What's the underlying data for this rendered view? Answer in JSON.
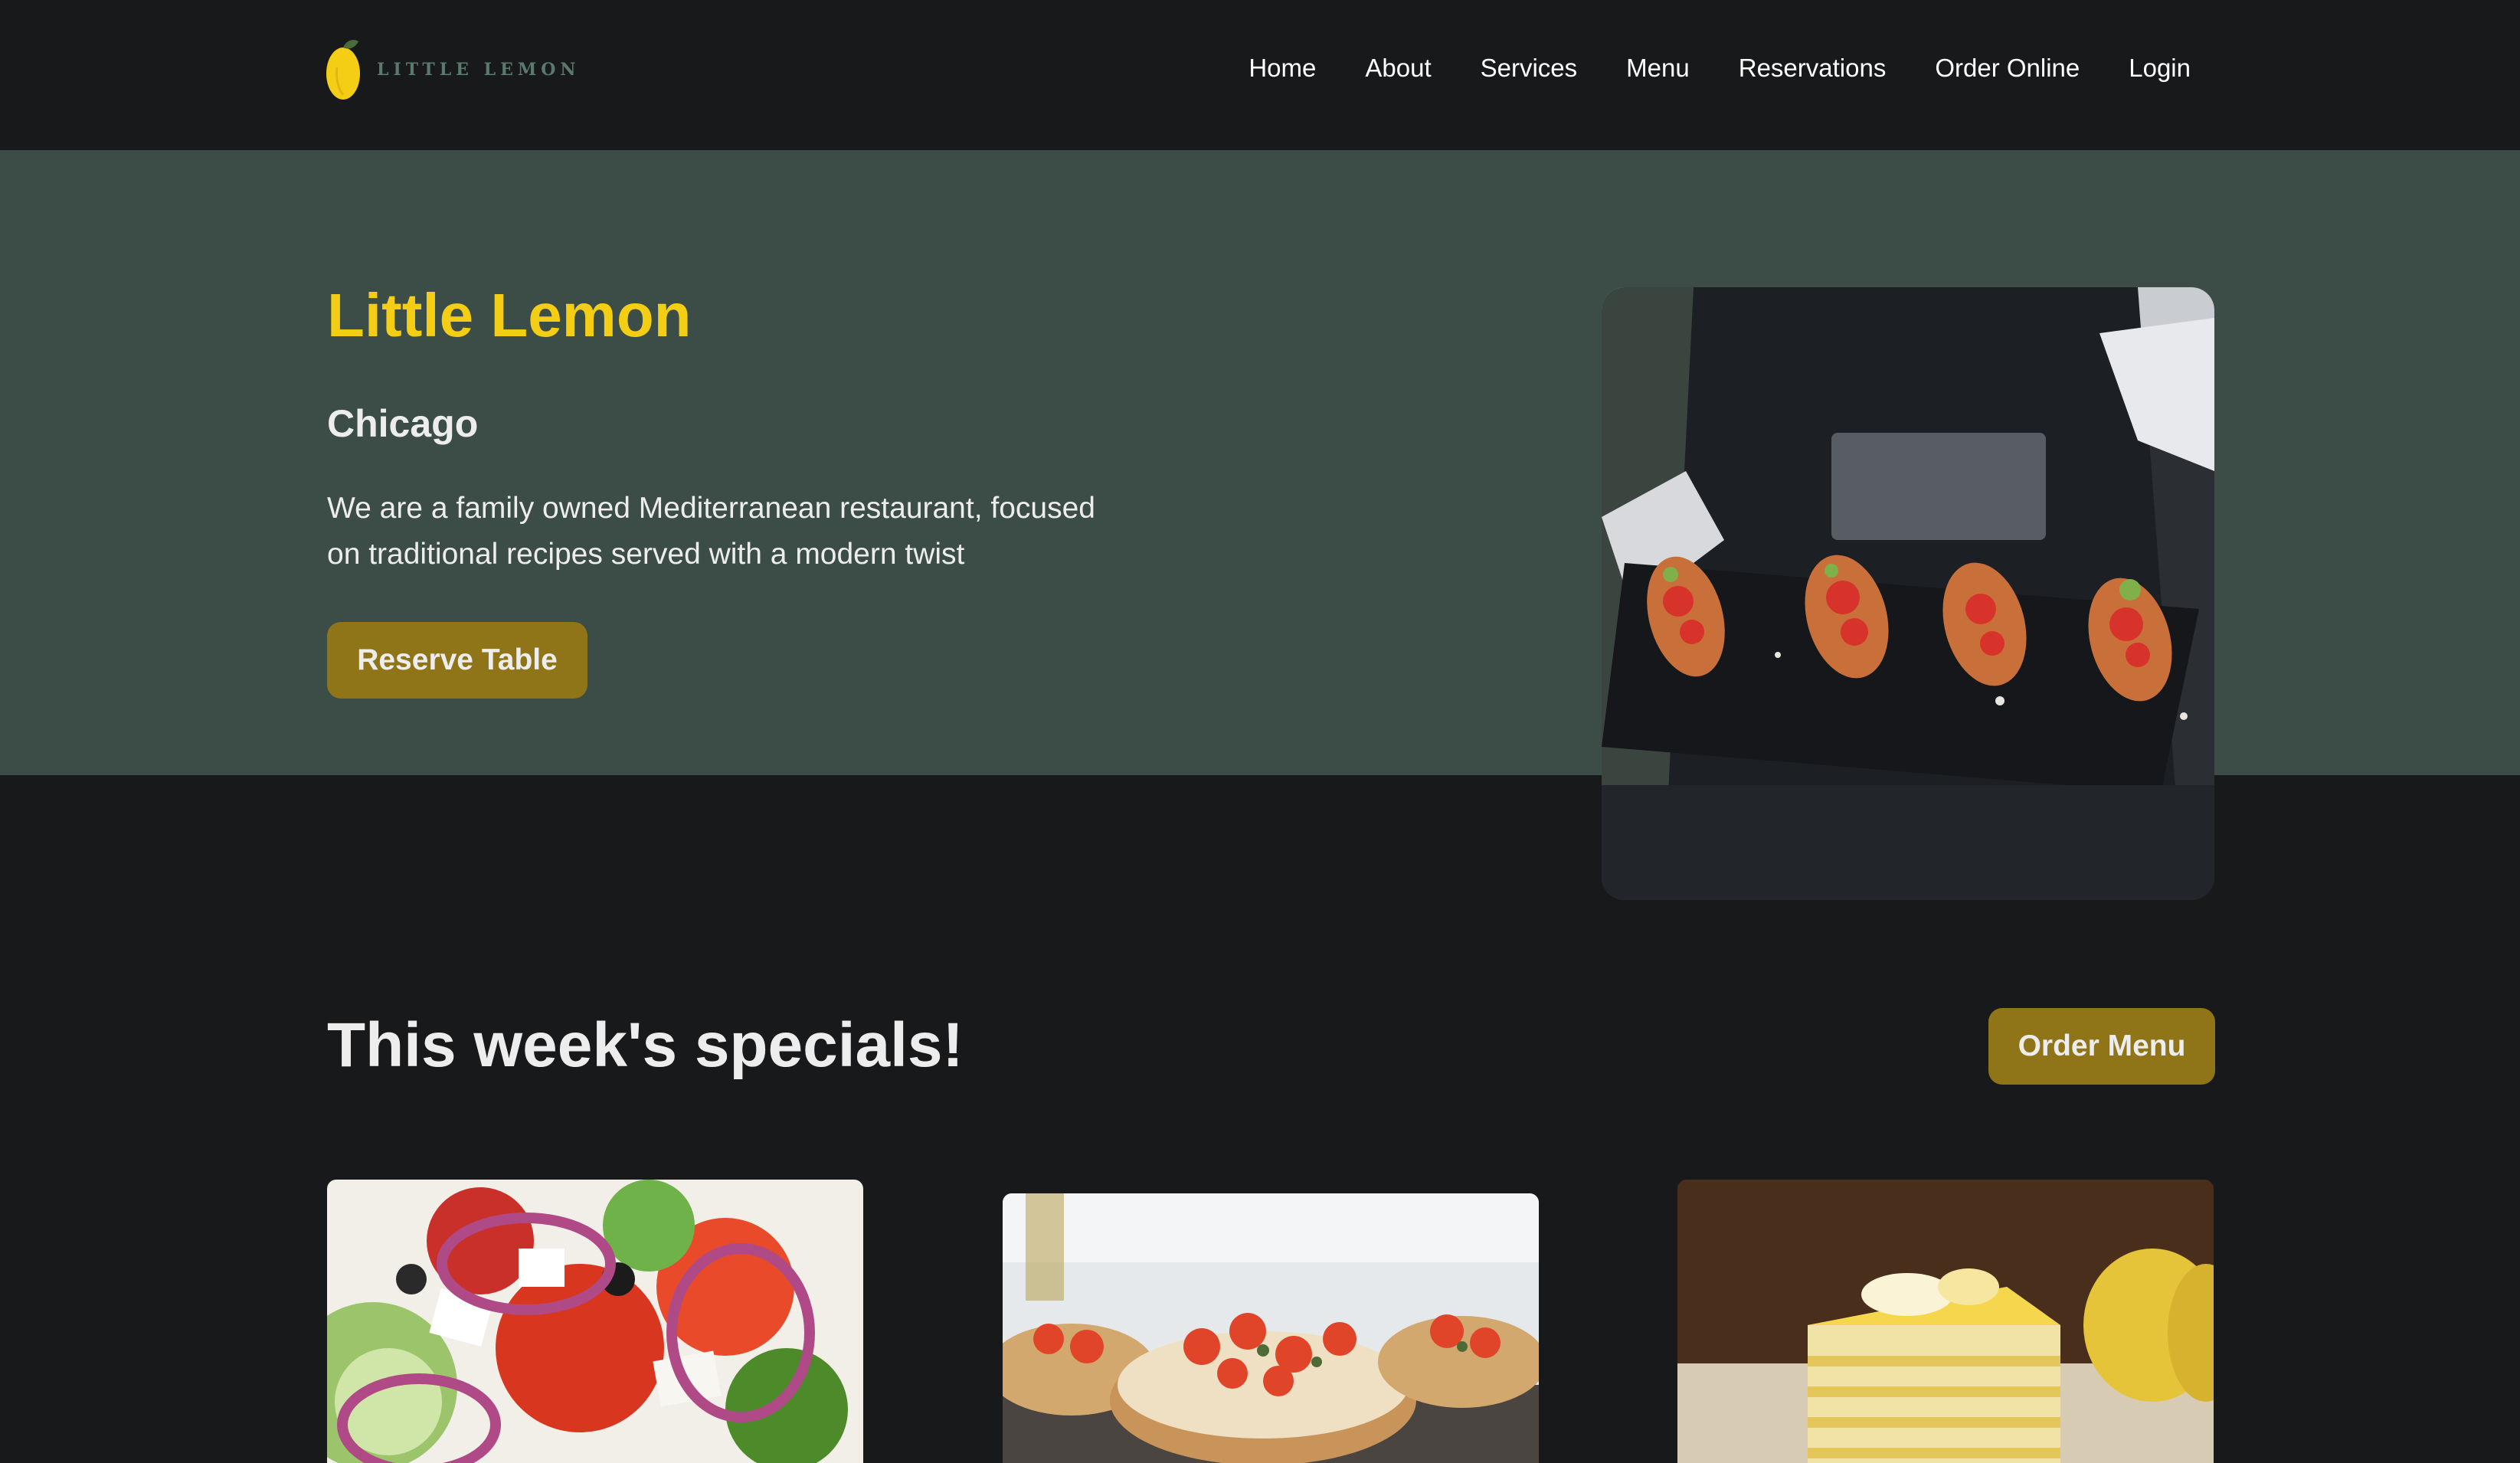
{
  "nav": {
    "logo_text": "LITTLE LEMON",
    "links": [
      "Home",
      "About",
      "Services",
      "Menu",
      "Reservations",
      "Order Online",
      "Login"
    ]
  },
  "hero": {
    "title": "Little Lemon",
    "subtitle": "Chicago",
    "description": "We are a family owned Mediterranean restaurant, focused on traditional recipes served with a modern twist",
    "button_label": "Reserve Table"
  },
  "specials": {
    "title": "This week's specials!",
    "button_label": "Order Menu"
  },
  "colors": {
    "background": "#18191b",
    "hero_background": "#3c4d47",
    "accent_yellow": "#f4ce14",
    "button": "#8f7518"
  }
}
